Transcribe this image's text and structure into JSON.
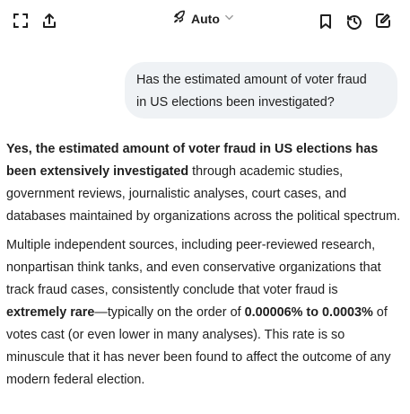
{
  "toolbar": {
    "expand_icon": "expand-icon",
    "share_icon": "share-icon",
    "model_icon": "rocket-icon",
    "model_label": "Auto",
    "model_chevron": "chevron-down-icon",
    "bookmark_icon": "bookmark-icon",
    "history_icon": "history-icon",
    "new_chat_icon": "edit-icon"
  },
  "conversation": {
    "user_message": {
      "line1": "Has the estimated amount of voter fraud",
      "line2": "in US elections been investigated?"
    },
    "assistant_message": {
      "p1": {
        "bold": "Yes, the estimated amount of voter fraud in US elections has been extensively investigated",
        "rest": " through academic studies, government reviews, journalistic analyses, court cases, and databases maintained by organizations across the political spectrum."
      },
      "p2": {
        "text1": "Multiple independent sources, including peer-reviewed research, nonpartisan think tanks, and even conservative organizations that track fraud cases, consistently conclude that voter fraud is ",
        "bold1": "extremely rare",
        "text2": "—typically on the order of ",
        "bold2": "0.00006% to 0.0003%",
        "text3": " of votes cast (or even lower in many analyses). This rate is so minuscule that it has never been found to affect the outcome of any modern federal election."
      }
    }
  },
  "colors": {
    "text": "#1f1f1f",
    "bubble_bg": "#eff2f5",
    "chevron": "#9a9a9a"
  }
}
